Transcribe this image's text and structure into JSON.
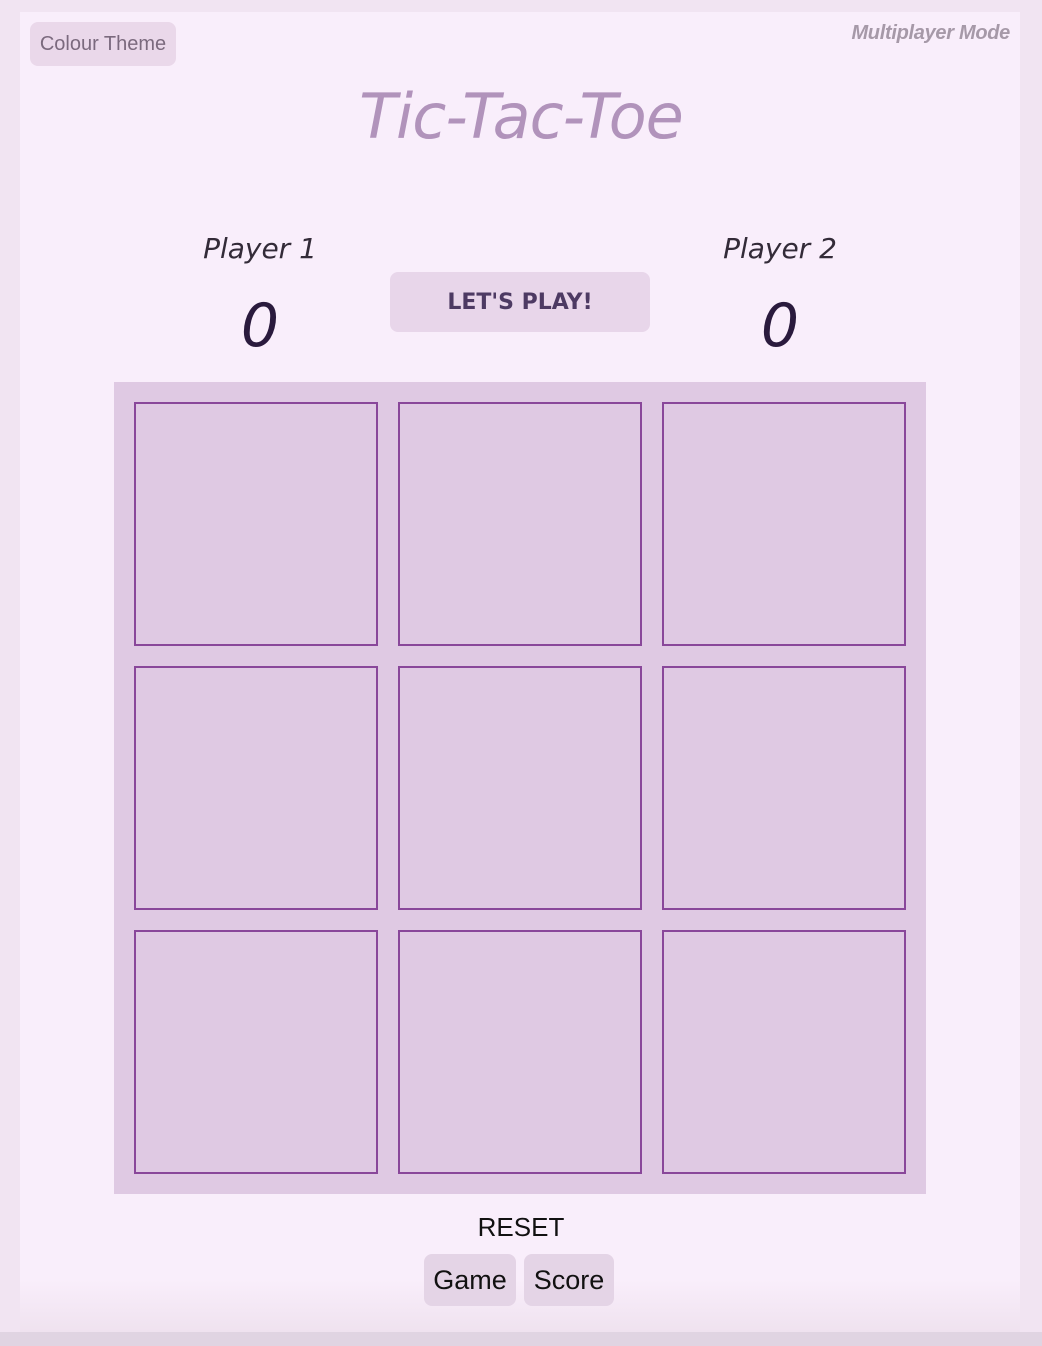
{
  "header": {
    "theme_button": "Colour Theme",
    "mode": "Multiplayer Mode",
    "title": "Tic-Tac-Toe"
  },
  "players": [
    {
      "name": "Player 1",
      "score": "0"
    },
    {
      "name": "Player 2",
      "score": "0"
    }
  ],
  "play_button": "LET'S PLAY!",
  "board": {
    "cells": [
      "",
      "",
      "",
      "",
      "",
      "",
      "",
      "",
      ""
    ]
  },
  "reset": {
    "label": "RESET",
    "game_button": "Game",
    "score_button": "Score"
  },
  "colors": {
    "background": "#f9eefb",
    "board": "#dfc9e3",
    "cell_border": "#89479a",
    "title": "#b193bb",
    "score": "#2a1a3d"
  }
}
